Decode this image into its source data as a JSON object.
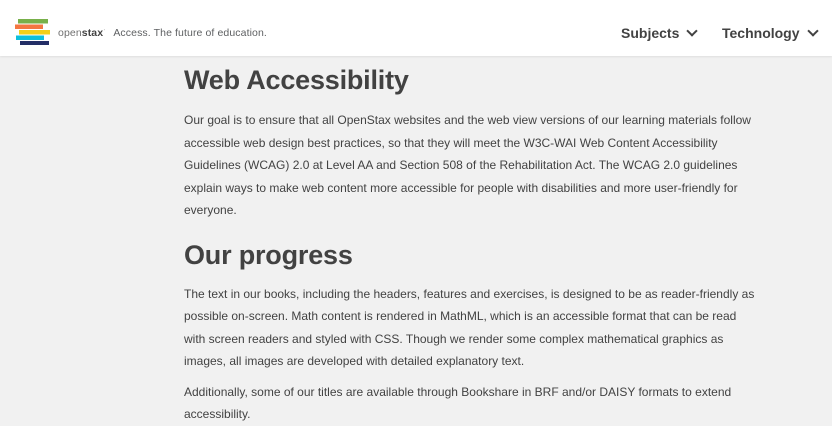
{
  "header": {
    "brand_open": "open",
    "brand_stax": "stax",
    "brand_tm": "·",
    "tagline": "Access. The future of education.",
    "nav": [
      {
        "label": "Subjects"
      },
      {
        "label": "Technology"
      }
    ]
  },
  "main": {
    "title": "Web Accessibility",
    "intro_lines": [
      "Our goal is to ensure that all OpenStax websites and the web view versions of our learning materials follow",
      "accessible web design best practices, so that they will meet the W3C-WAI Web Content Accessibility",
      "Guidelines (WCAG) 2.0 at Level AA and Section 508 of the Rehabilitation Act. The WCAG 2.0 guidelines",
      "explain ways to make web content more accessible for people with disabilities and more user-friendly for",
      "everyone."
    ],
    "progress_title": "Our progress",
    "progress_lines": [
      "The text in our books, including the headers, features and exercises, is designed to be as reader-friendly as",
      "possible on-screen. Math content is rendered in MathML, which is an accessible format that can be read",
      "with screen readers and styled with CSS. Though we render some complex mathematical graphics as",
      "images, all images are developed with detailed explanatory text."
    ],
    "extra_lines": [
      "Additionally, some of our titles are available through Bookshare in BRF and/or DAISY formats to extend",
      "accessibility."
    ]
  },
  "colors": {
    "logo_green": "#78b04a",
    "logo_orange": "#f47641",
    "logo_yellow": "#f4d019",
    "logo_blue": "#0dc0dc",
    "logo_dark": "#232e66",
    "background": "#f1f1f1",
    "text": "#424242"
  },
  "icons": [
    "openstax-logo-icon",
    "chevron-down-icon"
  ]
}
